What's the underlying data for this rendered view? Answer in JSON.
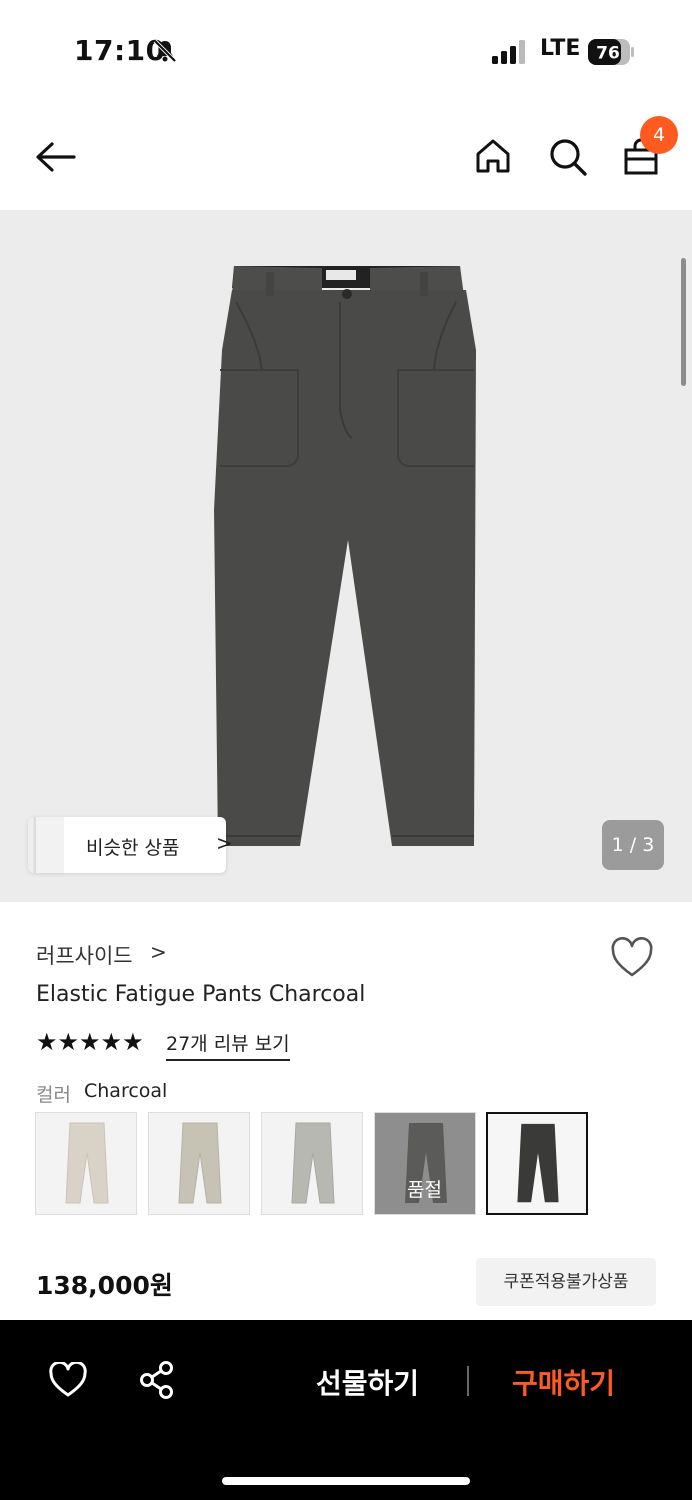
{
  "status": {
    "time": "17:10",
    "network": "LTE",
    "battery": "76"
  },
  "header": {
    "back_icon": "arrow-left-icon",
    "home_icon": "home-icon",
    "search_icon": "search-icon",
    "cart_icon": "shopping-bag-icon",
    "cart_count": "4"
  },
  "gallery": {
    "similar_label": "비슷한 상품",
    "similar_chevron": ">",
    "pager": "1 / 3"
  },
  "product": {
    "brand": "러프사이드",
    "brand_chevron": ">",
    "name": "Elastic Fatigue Pants Charcoal",
    "stars": "★★★★★",
    "rating": 5,
    "review_link": "27개 리뷰 보기",
    "color_label": "컬러",
    "color_value": "Charcoal",
    "swatches": [
      {
        "color": "#d8d3c6",
        "sold_out": false,
        "selected": false
      },
      {
        "color": "#c6c3b5",
        "sold_out": false,
        "selected": false
      },
      {
        "color": "#b8b8b3",
        "sold_out": false,
        "selected": false
      },
      {
        "color": "#5b5c59",
        "sold_out": true,
        "selected": false,
        "label": "품절"
      },
      {
        "color": "#3a3b38",
        "sold_out": false,
        "selected": true
      }
    ],
    "price": "138,000원",
    "coupon_badge": "쿠폰적용불가상품"
  },
  "bottom_bar": {
    "gift_label": "선물하기",
    "buy_label": "구매하기",
    "like_icon": "heart-icon",
    "share_icon": "share-icon"
  },
  "colors": {
    "accent": "#ff5a1f",
    "bar": "#000000",
    "pants": "#4a4b48"
  }
}
